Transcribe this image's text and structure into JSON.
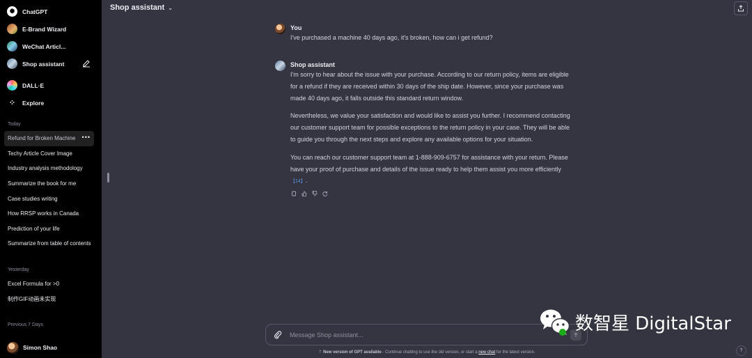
{
  "sidebar": {
    "gpts": [
      {
        "label": "ChatGPT",
        "icon": "openai-logo-icon"
      },
      {
        "label": "E-Brand Wizard",
        "icon": "ebrand-wizard-avatar-icon"
      },
      {
        "label": "WeChat Articl...",
        "icon": "wechat-article-avatar-icon"
      },
      {
        "label": "Shop assistant",
        "icon": "shop-assistant-avatar-icon"
      },
      {
        "label": "DALL·E",
        "icon": "dalle-avatar-icon"
      },
      {
        "label": "Explore",
        "icon": "explore-grid-icon"
      }
    ],
    "sections": [
      {
        "label": "Today",
        "items": [
          "Refund for Broken Machine",
          "Techy Article Cover Image",
          "Industry analysis methodology",
          "Summarize the book for me",
          "Case studies writing",
          "How RRSP works in Canada",
          "Prediction of your life",
          "Summarize from table of contents"
        ]
      },
      {
        "label": "Yesterday",
        "items": [
          "Excel Formula for >0",
          "制作GIF动画未实现"
        ]
      },
      {
        "label": "Previous 7 Days",
        "items": []
      }
    ],
    "user": {
      "name": "Simon Shao"
    }
  },
  "header": {
    "title": "Shop assistant"
  },
  "conversation": [
    {
      "author": "You",
      "paragraphs": [
        "I've purchased a machine 40 days ago, it's broken, how can i get refund?"
      ]
    },
    {
      "author": "Shop assistant",
      "paragraphs": [
        "I'm sorry to hear about the issue with your purchase. According to our return policy, items are eligible for a refund if they are received within 30 days of the ship date. However, since your purchase was made 40 days ago, it falls outside this standard return window.",
        "Nevertheless, we value your satisfaction and would like to assist you further. I recommend contacting our customer support team for possible exceptions to the return policy in your case. They will be able to guide you through the next steps and explore any available options for your situation.",
        "You can reach our customer support team at 1-888-909-6757 for assistance with your return. Please have your proof of purchase and details of the issue ready to help them assist you more efficiently"
      ],
      "citation": "【14】"
    }
  ],
  "composer": {
    "placeholder": "Message Shop assistant..."
  },
  "notice": {
    "bold": "New version of GPT available",
    "text": " - Continue chatting to use the old version, or start a ",
    "link": "new chat",
    "tail": " for the latest version."
  },
  "help": "?",
  "watermark": {
    "text": "数智星 DigitalStar"
  }
}
